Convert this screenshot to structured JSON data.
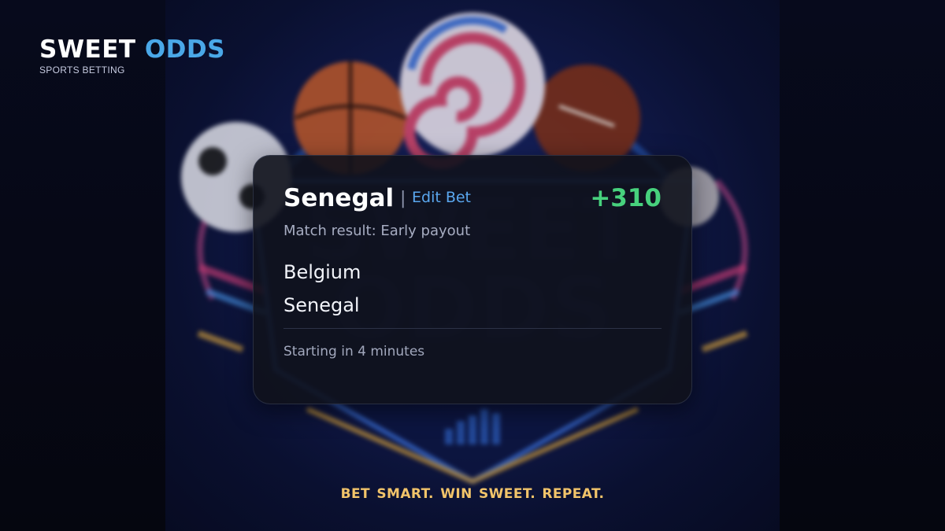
{
  "brand": {
    "name_primary": "SWEET",
    "name_accent": "ODDS",
    "subtitle": "SPORTS BETTING"
  },
  "bet_card": {
    "selection": "Senegal",
    "separator": "|",
    "edit_label": "Edit Bet",
    "odds": "+310",
    "market": "Match result: Early payout",
    "teams": [
      "Belgium",
      "Senegal"
    ],
    "status": "Starting in 4 minutes"
  },
  "background_art": {
    "description_icons": [
      "basketball-icon",
      "candy-swirl-icon",
      "football-icon",
      "soccer-ball-icon",
      "chart-icon"
    ]
  },
  "tagline": "BET SMART.  WIN SWEET.  REPEAT.",
  "colors": {
    "brand_accent": "#4aa8e8",
    "edit_link": "#5aa7ef",
    "odds_positive": "#47d17d",
    "tagline": "#f2c46a",
    "card_bg": "#10121c"
  }
}
